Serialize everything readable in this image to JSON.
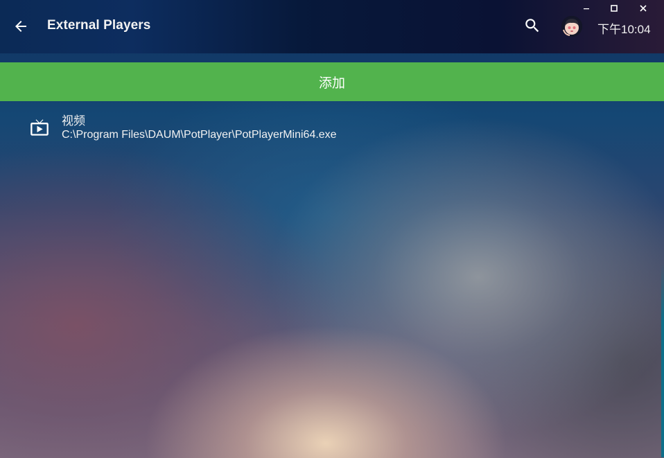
{
  "header": {
    "title": "External Players",
    "clock": "下午10:04"
  },
  "icons": {
    "back": "arrow-left-icon",
    "search": "search-icon",
    "avatar": "user-avatar",
    "minimize": "minimize-icon",
    "maximize": "maximize-icon",
    "close": "close-icon",
    "player": "tv-play-icon"
  },
  "add_button": {
    "label": "添加"
  },
  "players": [
    {
      "name": "视频",
      "path": "C:\\Program Files\\DAUM\\PotPlayer\\PotPlayerMini64.exe"
    }
  ],
  "colors": {
    "accent": "#52b34d",
    "header_bg": "#0a1c40"
  }
}
